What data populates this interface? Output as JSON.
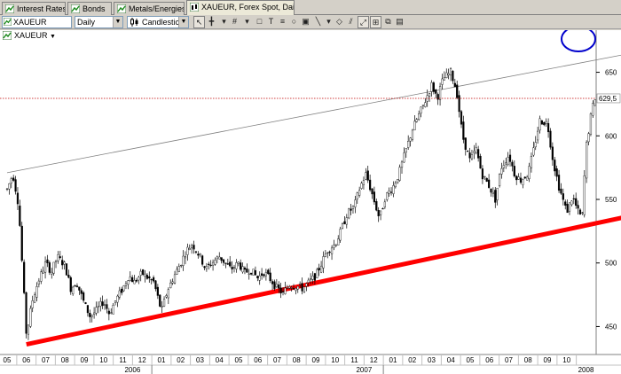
{
  "tabs": [
    {
      "label": "Interest Rates",
      "icon": "chart-tab-icon",
      "active": false
    },
    {
      "label": "Bonds",
      "icon": "chart-tab-icon",
      "active": false
    },
    {
      "label": "Metals/Energies",
      "icon": "chart-tab-icon",
      "active": false
    },
    {
      "label": "XAUEUR, Forex Spot, Daily",
      "icon": "chart-tab-icon",
      "active": true
    }
  ],
  "toolbar": {
    "symbol": "XAUEUR",
    "period": "Daily",
    "chart_style": "Candlestick"
  },
  "series_label": "XAUEUR",
  "colors": {
    "support_line": "#ff0000",
    "resistance_line": "#808080",
    "price_line": "#c00000",
    "circle": "#0000cc",
    "candles": "#000000"
  },
  "chart_data": {
    "type": "candlestick",
    "symbol": "XAUEUR",
    "period": "Daily",
    "y_ticks": [
      450,
      500,
      550,
      600,
      650
    ],
    "ylim": [
      428,
      672
    ],
    "last_price_label": "629,5",
    "month_labels": [
      "05",
      "06",
      "07",
      "08",
      "09",
      "10",
      "11",
      "12",
      "01",
      "02",
      "03",
      "04",
      "05",
      "06",
      "07",
      "08",
      "09",
      "10",
      "11",
      "12",
      "01",
      "02",
      "03",
      "04",
      "05",
      "06",
      "07",
      "08",
      "09",
      "10"
    ],
    "year_labels": [
      "2006",
      "2007",
      "2008"
    ],
    "year_label_months": [
      6.5,
      18.5,
      30
    ],
    "price_path": [
      [
        0,
        558
      ],
      [
        0.3,
        570
      ],
      [
        0.6,
        545
      ],
      [
        1.0,
        443
      ],
      [
        1.3,
        470
      ],
      [
        1.6,
        485
      ],
      [
        2.0,
        500
      ],
      [
        2.3,
        493
      ],
      [
        2.6,
        505
      ],
      [
        3.0,
        498
      ],
      [
        3.3,
        480
      ],
      [
        3.6,
        485
      ],
      [
        4.0,
        468
      ],
      [
        4.3,
        458
      ],
      [
        4.6,
        462
      ],
      [
        5.0,
        470
      ],
      [
        5.3,
        460
      ],
      [
        5.6,
        470
      ],
      [
        6.0,
        480
      ],
      [
        6.3,
        490
      ],
      [
        6.6,
        485
      ],
      [
        7.0,
        492
      ],
      [
        7.3,
        488
      ],
      [
        7.6,
        485
      ],
      [
        8.0,
        462
      ],
      [
        8.3,
        478
      ],
      [
        8.6,
        488
      ],
      [
        9.0,
        500
      ],
      [
        9.3,
        510
      ],
      [
        9.6,
        515
      ],
      [
        10.0,
        505
      ],
      [
        10.3,
        495
      ],
      [
        10.6,
        500
      ],
      [
        11.0,
        505
      ],
      [
        11.3,
        500
      ],
      [
        11.6,
        495
      ],
      [
        12.0,
        500
      ],
      [
        12.3,
        492
      ],
      [
        12.6,
        495
      ],
      [
        13.0,
        488
      ],
      [
        13.3,
        493
      ],
      [
        13.6,
        488
      ],
      [
        14.0,
        480
      ],
      [
        14.3,
        476
      ],
      [
        14.6,
        483
      ],
      [
        15.0,
        482
      ],
      [
        15.3,
        480
      ],
      [
        15.6,
        484
      ],
      [
        16.0,
        490
      ],
      [
        16.3,
        500
      ],
      [
        16.6,
        510
      ],
      [
        17.0,
        515
      ],
      [
        17.3,
        525
      ],
      [
        17.6,
        538
      ],
      [
        18.0,
        545
      ],
      [
        18.3,
        560
      ],
      [
        18.6,
        570
      ],
      [
        19.0,
        550
      ],
      [
        19.3,
        535
      ],
      [
        19.6,
        552
      ],
      [
        20.0,
        560
      ],
      [
        20.3,
        570
      ],
      [
        20.6,
        585
      ],
      [
        21.0,
        605
      ],
      [
        21.3,
        615
      ],
      [
        21.6,
        625
      ],
      [
        22.0,
        640
      ],
      [
        22.3,
        630
      ],
      [
        22.6,
        645
      ],
      [
        23.0,
        650
      ],
      [
        23.3,
        635
      ],
      [
        23.6,
        600
      ],
      [
        24.0,
        580
      ],
      [
        24.3,
        590
      ],
      [
        24.6,
        570
      ],
      [
        25.0,
        560
      ],
      [
        25.3,
        550
      ],
      [
        25.6,
        575
      ],
      [
        26.0,
        585
      ],
      [
        26.3,
        570
      ],
      [
        26.6,
        565
      ],
      [
        27.0,
        570
      ],
      [
        27.3,
        590
      ],
      [
        27.6,
        612
      ],
      [
        28.0,
        610
      ],
      [
        28.3,
        580
      ],
      [
        28.6,
        560
      ],
      [
        29.0,
        540
      ],
      [
        29.3,
        552
      ],
      [
        29.6,
        540
      ],
      [
        29.8,
        535
      ],
      [
        30.0,
        590
      ],
      [
        30.3,
        620
      ],
      [
        30.5,
        632
      ]
    ],
    "trendlines": [
      {
        "name": "support",
        "points": [
          [
            1.0,
            436
          ],
          [
            32.0,
            536
          ]
        ]
      },
      {
        "name": "resistance",
        "points": [
          [
            0,
            571
          ],
          [
            32.0,
            664
          ]
        ]
      }
    ],
    "horizontal_line": 629.5
  }
}
